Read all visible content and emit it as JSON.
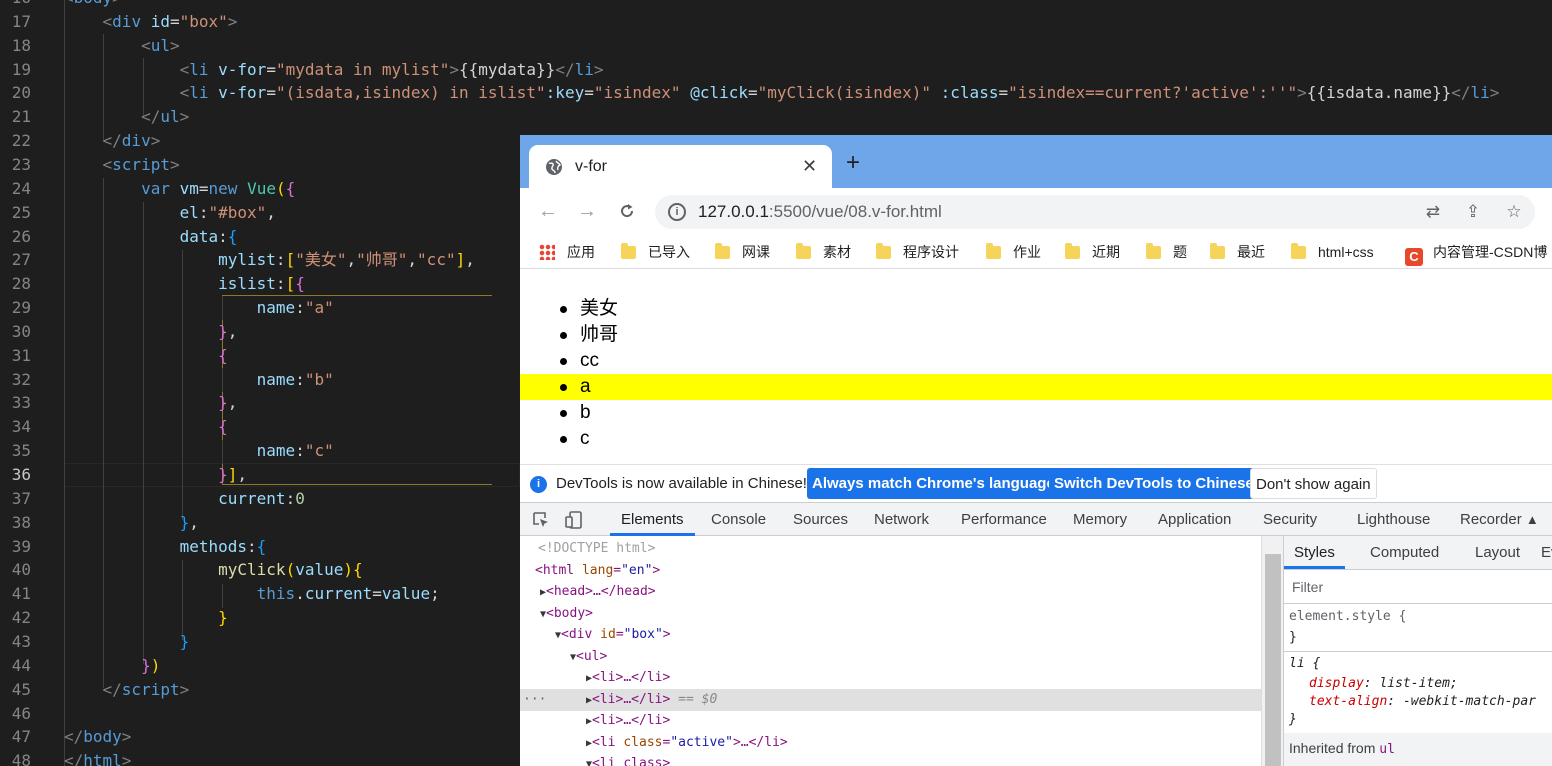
{
  "editor": {
    "lines": [
      {
        "n": "16",
        "tokens": [
          {
            "t": "<",
            "c": "pun"
          },
          {
            "t": "body",
            "c": "tag"
          },
          {
            "t": ">",
            "c": "pun"
          }
        ]
      },
      {
        "n": "17",
        "tokens": [
          {
            "t": "    "
          },
          {
            "t": "<",
            "c": "pun"
          },
          {
            "t": "div",
            "c": "tag"
          },
          {
            "t": " "
          },
          {
            "t": "id",
            "c": "attr"
          },
          {
            "t": "=",
            "c": "txt"
          },
          {
            "t": "\"box\"",
            "c": "str"
          },
          {
            "t": ">",
            "c": "pun"
          }
        ]
      },
      {
        "n": "18",
        "tokens": [
          {
            "t": "        "
          },
          {
            "t": "<",
            "c": "pun"
          },
          {
            "t": "ul",
            "c": "tag"
          },
          {
            "t": ">",
            "c": "pun"
          }
        ]
      },
      {
        "n": "19",
        "tokens": [
          {
            "t": "            "
          },
          {
            "t": "<",
            "c": "pun"
          },
          {
            "t": "li",
            "c": "tag"
          },
          {
            "t": " "
          },
          {
            "t": "v-for",
            "c": "attr"
          },
          {
            "t": "=",
            "c": "txt"
          },
          {
            "t": "\"mydata in mylist\"",
            "c": "str"
          },
          {
            "t": ">",
            "c": "pun"
          },
          {
            "t": "{{mydata}}",
            "c": "txt"
          },
          {
            "t": "</",
            "c": "pun"
          },
          {
            "t": "li",
            "c": "tag"
          },
          {
            "t": ">",
            "c": "pun"
          }
        ]
      },
      {
        "n": "20",
        "tokens": [
          {
            "t": "            "
          },
          {
            "t": "<",
            "c": "pun"
          },
          {
            "t": "li",
            "c": "tag"
          },
          {
            "t": " "
          },
          {
            "t": "v-for",
            "c": "attr"
          },
          {
            "t": "=",
            "c": "txt"
          },
          {
            "t": "\"(isdata,isindex) in islist\"",
            "c": "str"
          },
          {
            "t": ":key",
            "c": "attr"
          },
          {
            "t": "=",
            "c": "txt"
          },
          {
            "t": "\"isindex\"",
            "c": "str"
          },
          {
            "t": " "
          },
          {
            "t": "@click",
            "c": "attr"
          },
          {
            "t": "=",
            "c": "txt"
          },
          {
            "t": "\"myClick(isindex)\"",
            "c": "str"
          },
          {
            "t": " "
          },
          {
            "t": ":class",
            "c": "attr"
          },
          {
            "t": "=",
            "c": "txt"
          },
          {
            "t": "\"isindex==current?'active':''\"",
            "c": "str"
          },
          {
            "t": ">",
            "c": "pun"
          },
          {
            "t": "{{isdata.name}}",
            "c": "txt"
          },
          {
            "t": "</",
            "c": "pun"
          },
          {
            "t": "li",
            "c": "tag"
          },
          {
            "t": ">",
            "c": "pun"
          }
        ]
      },
      {
        "n": "21",
        "tokens": [
          {
            "t": "        "
          },
          {
            "t": "</",
            "c": "pun"
          },
          {
            "t": "ul",
            "c": "tag"
          },
          {
            "t": ">",
            "c": "pun"
          }
        ]
      },
      {
        "n": "22",
        "tokens": [
          {
            "t": "    "
          },
          {
            "t": "</",
            "c": "pun"
          },
          {
            "t": "div",
            "c": "tag"
          },
          {
            "t": ">",
            "c": "pun"
          }
        ]
      },
      {
        "n": "23",
        "tokens": [
          {
            "t": "    "
          },
          {
            "t": "<",
            "c": "pun"
          },
          {
            "t": "script",
            "c": "tag"
          },
          {
            "t": ">",
            "c": "pun"
          }
        ]
      },
      {
        "n": "24",
        "tokens": [
          {
            "t": "        "
          },
          {
            "t": "var",
            "c": "kw"
          },
          {
            "t": " "
          },
          {
            "t": "vm",
            "c": "attr"
          },
          {
            "t": "=",
            "c": "txt"
          },
          {
            "t": "new",
            "c": "kw"
          },
          {
            "t": " "
          },
          {
            "t": "Vue",
            "c": "cls"
          },
          {
            "t": "(",
            "c": "b1"
          },
          {
            "t": "{",
            "c": "b2"
          }
        ]
      },
      {
        "n": "25",
        "tokens": [
          {
            "t": "            "
          },
          {
            "t": "el",
            "c": "attr"
          },
          {
            "t": ":",
            "c": "txt"
          },
          {
            "t": "\"#box\"",
            "c": "str"
          },
          {
            "t": ",",
            "c": "txt"
          }
        ]
      },
      {
        "n": "26",
        "tokens": [
          {
            "t": "            "
          },
          {
            "t": "data",
            "c": "attr"
          },
          {
            "t": ":",
            "c": "txt"
          },
          {
            "t": "{",
            "c": "b3"
          }
        ]
      },
      {
        "n": "27",
        "tokens": [
          {
            "t": "                "
          },
          {
            "t": "mylist",
            "c": "attr"
          },
          {
            "t": ":",
            "c": "txt"
          },
          {
            "t": "[",
            "c": "b1"
          },
          {
            "t": "\"美女\"",
            "c": "str"
          },
          {
            "t": ",",
            "c": "txt"
          },
          {
            "t": "\"帅哥\"",
            "c": "str"
          },
          {
            "t": ",",
            "c": "txt"
          },
          {
            "t": "\"cc\"",
            "c": "str"
          },
          {
            "t": "]",
            "c": "b1"
          },
          {
            "t": ",",
            "c": "txt"
          }
        ]
      },
      {
        "n": "28",
        "tokens": [
          {
            "t": "                "
          },
          {
            "t": "islist",
            "c": "attr"
          },
          {
            "t": ":",
            "c": "txt"
          },
          {
            "t": "[",
            "c": "b1"
          },
          {
            "t": "{",
            "c": "b2"
          }
        ]
      },
      {
        "n": "29",
        "tokens": [
          {
            "t": "                    "
          },
          {
            "t": "name",
            "c": "attr"
          },
          {
            "t": ":",
            "c": "txt"
          },
          {
            "t": "\"a\"",
            "c": "str"
          }
        ]
      },
      {
        "n": "30",
        "tokens": [
          {
            "t": "                "
          },
          {
            "t": "}",
            "c": "b2"
          },
          {
            "t": ",",
            "c": "txt"
          }
        ]
      },
      {
        "n": "31",
        "tokens": [
          {
            "t": "                "
          },
          {
            "t": "{",
            "c": "b2"
          }
        ]
      },
      {
        "n": "32",
        "tokens": [
          {
            "t": "                    "
          },
          {
            "t": "name",
            "c": "attr"
          },
          {
            "t": ":",
            "c": "txt"
          },
          {
            "t": "\"b\"",
            "c": "str"
          }
        ]
      },
      {
        "n": "33",
        "tokens": [
          {
            "t": "                "
          },
          {
            "t": "}",
            "c": "b2"
          },
          {
            "t": ",",
            "c": "txt"
          }
        ]
      },
      {
        "n": "34",
        "tokens": [
          {
            "t": "                "
          },
          {
            "t": "{",
            "c": "b2"
          }
        ]
      },
      {
        "n": "35",
        "tokens": [
          {
            "t": "                    "
          },
          {
            "t": "name",
            "c": "attr"
          },
          {
            "t": ":",
            "c": "txt"
          },
          {
            "t": "\"c\"",
            "c": "str"
          }
        ]
      },
      {
        "n": "36",
        "tokens": [
          {
            "t": "                "
          },
          {
            "t": "}",
            "c": "b2"
          },
          {
            "t": "]",
            "c": "b1"
          },
          {
            "t": ",",
            "c": "txt"
          }
        ]
      },
      {
        "n": "37",
        "tokens": [
          {
            "t": "                "
          },
          {
            "t": "current",
            "c": "attr"
          },
          {
            "t": ":",
            "c": "txt"
          },
          {
            "t": "0",
            "c": "num"
          }
        ]
      },
      {
        "n": "38",
        "tokens": [
          {
            "t": "            "
          },
          {
            "t": "}",
            "c": "b3"
          },
          {
            "t": ",",
            "c": "txt"
          }
        ]
      },
      {
        "n": "39",
        "tokens": [
          {
            "t": "            "
          },
          {
            "t": "methods",
            "c": "attr"
          },
          {
            "t": ":",
            "c": "txt"
          },
          {
            "t": "{",
            "c": "b3"
          }
        ]
      },
      {
        "n": "40",
        "tokens": [
          {
            "t": "                "
          },
          {
            "t": "myClick",
            "c": "fn"
          },
          {
            "t": "(",
            "c": "b1"
          },
          {
            "t": "value",
            "c": "attr"
          },
          {
            "t": ")",
            "c": "b1"
          },
          {
            "t": "{",
            "c": "b1"
          }
        ]
      },
      {
        "n": "41",
        "tokens": [
          {
            "t": "                    "
          },
          {
            "t": "this",
            "c": "kw"
          },
          {
            "t": ".",
            "c": "txt"
          },
          {
            "t": "current",
            "c": "attr"
          },
          {
            "t": "=",
            "c": "txt"
          },
          {
            "t": "value",
            "c": "attr"
          },
          {
            "t": ";",
            "c": "txt"
          }
        ]
      },
      {
        "n": "42",
        "tokens": [
          {
            "t": "                "
          },
          {
            "t": "}",
            "c": "b1"
          }
        ]
      },
      {
        "n": "43",
        "tokens": [
          {
            "t": "            "
          },
          {
            "t": "}",
            "c": "b3"
          }
        ]
      },
      {
        "n": "44",
        "tokens": [
          {
            "t": "        "
          },
          {
            "t": "}",
            "c": "b2"
          },
          {
            "t": ")",
            "c": "b1"
          }
        ]
      },
      {
        "n": "45",
        "tokens": [
          {
            "t": "    "
          },
          {
            "t": "</",
            "c": "pun"
          },
          {
            "t": "script",
            "c": "tag"
          },
          {
            "t": ">",
            "c": "pun"
          }
        ]
      },
      {
        "n": "46",
        "tokens": []
      },
      {
        "n": "47",
        "tokens": [
          {
            "t": "</",
            "c": "pun"
          },
          {
            "t": "body",
            "c": "tag"
          },
          {
            "t": ">",
            "c": "pun"
          }
        ]
      },
      {
        "n": "48",
        "tokens": [
          {
            "t": "</",
            "c": "pun"
          },
          {
            "t": "html",
            "c": "tag"
          },
          {
            "t": ">",
            "c": "pun"
          }
        ]
      }
    ],
    "current_line": "36"
  },
  "browser": {
    "tab_title": "v-for",
    "tab_close": "✕",
    "new_tab": "+",
    "url_host": "127.0.0.1",
    "url_rest": ":5500/vue/08.v-for.html",
    "bookmarks": [
      "应用",
      "已导入",
      "网课",
      "素材",
      "程序设计",
      "作业",
      "近期",
      "题",
      "最近",
      "html+css",
      "内容管理-CSDN博"
    ],
    "page_items": [
      "美女",
      "帅哥",
      "cc",
      "a",
      "b",
      "c"
    ],
    "active_item_index": 3,
    "infobar": {
      "message": "DevTools is now available in Chinese!",
      "btn_match": "Always match Chrome's language",
      "btn_switch": "Switch DevTools to Chinese",
      "btn_dismiss": "Don't show again"
    },
    "devtools_tabs": [
      "Elements",
      "Console",
      "Sources",
      "Network",
      "Performance",
      "Memory",
      "Application",
      "Security",
      "Lighthouse",
      "Recorder"
    ],
    "dom": {
      "doctype": "<!DOCTYPE html>",
      "html_open": "<html lang=\"en\">",
      "head": "<head>…</head>",
      "body": "<body>",
      "div": "<div id=\"box\">",
      "ul": "<ul>",
      "li1": "<li>…</li>",
      "li2": "<li>…</li>",
      "li2_suffix": "== $0",
      "li3": "<li>…</li>",
      "li4": "<li class=\"active\">…</li>",
      "li5": "<li class>",
      "selected_dots": "···"
    },
    "styles": {
      "tabs": [
        "Styles",
        "Computed",
        "Layout",
        "Even"
      ],
      "filter_placeholder": "Filter",
      "element_style_open": "element.style {",
      "element_style_close": "}",
      "li_rule_open": "li {",
      "prop1_name": "display",
      "prop1_value": "list-item;",
      "prop2_name": "text-align",
      "prop2_value": "-webkit-match-par",
      "li_rule_close": "}",
      "inherited_label": "Inherited from",
      "inherited_ref": "ul"
    },
    "colors": {
      "tabstrip": "#6fa6ea",
      "active_highlight": "#ffff00",
      "devtools_accent": "#1a73e8"
    }
  }
}
